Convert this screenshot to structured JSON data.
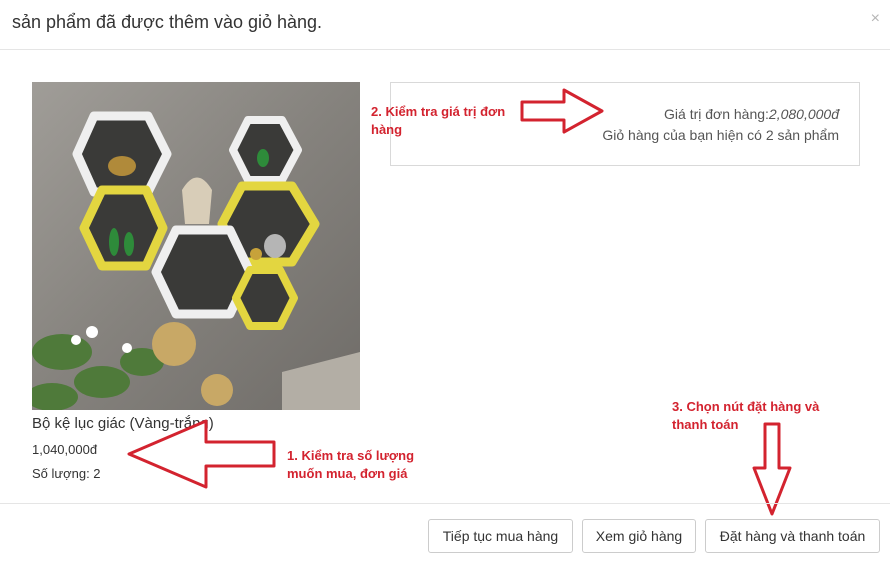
{
  "modal": {
    "title": "sản phẩm đã được thêm vào giỏ hàng.",
    "close_label": "×"
  },
  "product": {
    "name": "Bộ kệ lục giác (Vàng-trắng)",
    "price": "1,040,000đ",
    "quantity": "Số lượng: 2"
  },
  "summary": {
    "order_value_label": "Giá trị đơn hàng:",
    "order_value": "2,080,000đ",
    "cart_count_text": "Giỏ hàng của bạn hiện có 2 sản phẩm"
  },
  "annotations": {
    "step1": "1. Kiểm tra số lượng muốn mua, đơn giá",
    "step2": "2. Kiểm tra giá trị đơn hàng",
    "step3": "3. Chọn nút đặt hàng và thanh toán"
  },
  "footer": {
    "continue_label": "Tiếp tục mua hàng",
    "view_cart_label": "Xem giỏ hàng",
    "checkout_label": "Đặt hàng và thanh toán"
  },
  "colors": {
    "annotation": "#d3232f",
    "shelf_yellow": "#e2d640",
    "shelf_white": "#f2f2f2",
    "wall": "#8c8a86"
  }
}
